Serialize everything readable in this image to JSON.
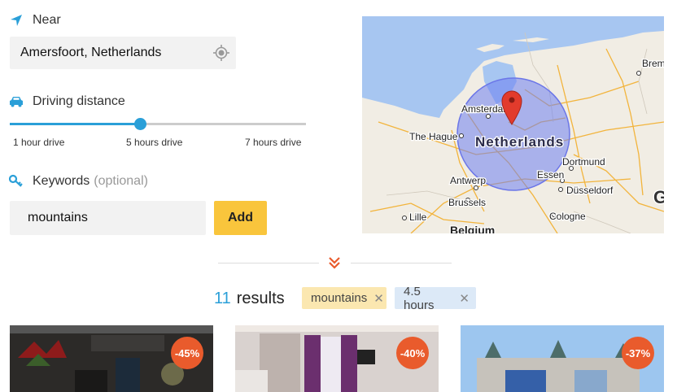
{
  "near": {
    "label": "Near",
    "value": "Amersfoort, Netherlands"
  },
  "driving": {
    "label": "Driving distance",
    "level_fraction": 0.44,
    "ticks": [
      "1 hour drive",
      "5 hours drive",
      "7 hours drive"
    ]
  },
  "keywords": {
    "label": "Keywords",
    "optional": "(optional)",
    "value": "mountains",
    "add_label": "Add"
  },
  "map": {
    "labels": {
      "bremen": "Bremen",
      "amsterdam": "Amsterdam",
      "hague": "The Hague",
      "netherlands": "Netherlands",
      "dortmund": "Dortmund",
      "antwerp": "Antwerp",
      "essen": "Essen",
      "dusseldorf": "Düsseldorf",
      "brussels": "Brussels",
      "cologne": "Cologne",
      "lille": "Lille",
      "belgium": "Belgium",
      "g": "G"
    }
  },
  "results": {
    "count": "11",
    "label": "results",
    "filters": [
      {
        "label": "mountains",
        "remove": "✕"
      },
      {
        "label": "4.5 hours",
        "remove": "✕"
      }
    ]
  },
  "cards": [
    {
      "discount": "-45%"
    },
    {
      "discount": "-40%"
    },
    {
      "discount": "-37%"
    }
  ],
  "colors": {
    "accent": "#2a9fd8",
    "add_button": "#f9c53c",
    "discount": "#e95b2c"
  },
  "icons": [
    "location-arrow-icon",
    "crosshair-icon",
    "car-icon",
    "key-icon",
    "double-chevron-down-icon",
    "map-pin-icon"
  ]
}
